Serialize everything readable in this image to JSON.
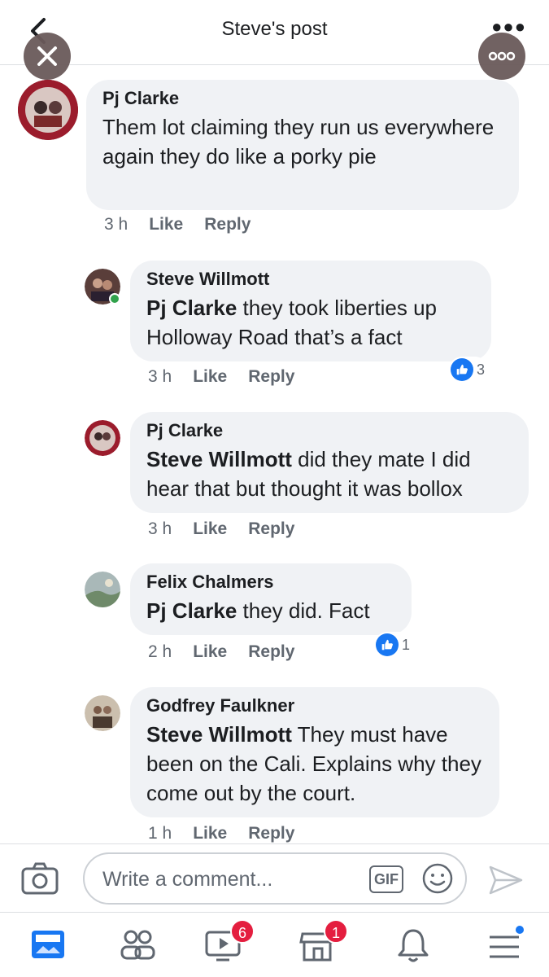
{
  "header": {
    "title": "Steve's post"
  },
  "comments": [
    {
      "author": "Pj Clarke",
      "tag": "",
      "text": "Them lot claiming they run us everywhere again they do like a porky pie",
      "time": "3 h",
      "like_label": "Like",
      "reply_label": "Reply",
      "reactions": ""
    },
    {
      "author": "Steve Willmott",
      "tag": "Pj Clarke",
      "text": " they took liberties up Holloway Road that’s a fact",
      "time": "3 h",
      "like_label": "Like",
      "reply_label": "Reply",
      "reactions": "3"
    },
    {
      "author": "Pj Clarke",
      "tag": "Steve Willmott",
      "text": " did they mate I did hear that but thought it was bollox",
      "time": "3 h",
      "like_label": "Like",
      "reply_label": "Reply",
      "reactions": ""
    },
    {
      "author": "Felix Chalmers",
      "tag": "Pj Clarke",
      "text": " they did. Fact",
      "time": "2 h",
      "like_label": "Like",
      "reply_label": "Reply",
      "reactions": "1"
    },
    {
      "author": "Godfrey Faulkner",
      "tag": "Steve Willmott",
      "text": " They must have been on the Cali. Explains why they come out by the court.",
      "time": "1 h",
      "like_label": "Like",
      "reply_label": "Reply",
      "reactions": ""
    }
  ],
  "composer": {
    "placeholder": "Write a comment...",
    "gif_label": "GIF"
  },
  "tabbar": {
    "watch_badge": "6",
    "marketplace_badge": "1"
  },
  "colors": {
    "accent": "#1877f2",
    "badge": "#e41e3f",
    "bubble": "#f0f2f5"
  }
}
